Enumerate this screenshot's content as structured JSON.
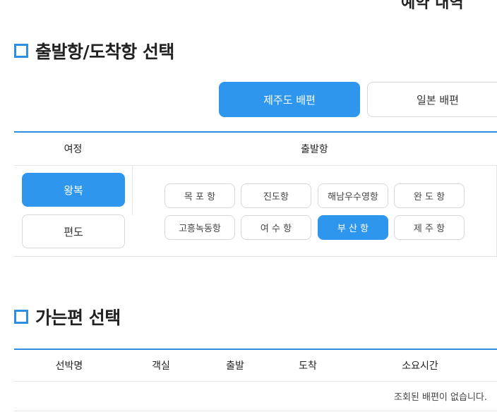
{
  "top_clipped_text": "예약 내역",
  "route_section": {
    "title": "출발항/도착항 선택",
    "routes": [
      {
        "label": "제주도 배편",
        "active": true
      },
      {
        "label": "일본 배편",
        "active": false
      }
    ],
    "headers": {
      "trip": "여정",
      "departure": "출발항"
    },
    "trip_types": [
      {
        "label": "왕복",
        "active": true
      },
      {
        "label": "편도",
        "active": false
      }
    ],
    "ports": [
      {
        "label": "목 포 항",
        "selected": false
      },
      {
        "label": "진도항",
        "selected": false
      },
      {
        "label": "해남우수영항",
        "selected": false
      },
      {
        "label": "완 도 항",
        "selected": false
      },
      {
        "label": "고흥녹동항",
        "selected": false
      },
      {
        "label": "여 수 항",
        "selected": false
      },
      {
        "label": "부 산 항",
        "selected": true
      },
      {
        "label": "제 주 항",
        "selected": false
      }
    ]
  },
  "ferry_section": {
    "title": "가는편 선택",
    "columns": [
      "선박명",
      "객실",
      "출발",
      "도착",
      "소요시간"
    ],
    "empty_message": "조회된 배편이 없습니다."
  },
  "colors": {
    "accent": "#2f96ee",
    "accent_line": "#2f8ee0",
    "border": "#d8d8d8"
  }
}
